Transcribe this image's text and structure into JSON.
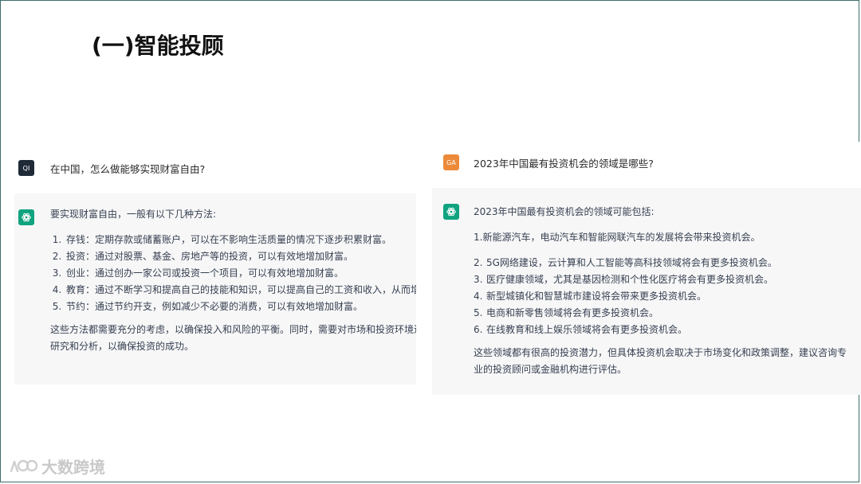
{
  "slide": {
    "title": "(一)智能投顾"
  },
  "left_chat": {
    "user_avatar": "QI",
    "question": "在中国，怎么做能够实现财富自由?",
    "answer": {
      "intro": "要实现财富自由，一般有以下几种方法:",
      "items": [
        "存钱：定期存款或储蓄账户，可以在不影响生活质量的情况下逐步积累财富。",
        "投资：通过对股票、基金、房地产等的投资，可以有效地增加财富。",
        "创业：通过创办一家公司或投资一个项目，可以有效地增加财富。",
        "教育：通过不断学习和提高自己的技能和知识，可以提高自己的工资和收入，从而增加财富。",
        "节约：通过节约开支，例如减少不必要的消费，可以有效地增加财富。"
      ],
      "outro": "这些方法都需要充分的考虑，以确保投入和风险的平衡。同时，需要对市场和投资环境进行充分的研究和分析，以确保投资的成功。"
    }
  },
  "right_chat": {
    "user_avatar": "GA",
    "question": "2023年中国最有投资机会的领域是哪些?",
    "answer": {
      "intro": "2023年中国最有投资机会的领域可能包括:",
      "first": "1.新能源汽车，电动汽车和智能网联汽车的发展将会带来投资机会。",
      "items": [
        {
          "num": "2.",
          "text": "5G网络建设，云计算和人工智能等高科技领域将会有更多投资机会。"
        },
        {
          "num": "3.",
          "text": "医疗健康领域，尤其是基因检测和个性化医疗将会有更多投资机会。"
        },
        {
          "num": "4.",
          "text": "新型城镇化和智慧城市建设将会带来更多投资机会。"
        },
        {
          "num": "5.",
          "text": "电商和新零售领域将会有更多投资机会。"
        },
        {
          "num": "6.",
          "text": "在线教育和线上娱乐领域将会有更多投资机会。"
        }
      ],
      "outro": "这些领域都有很高的投资潜力，但具体投资机会取决于市场变化和政策调整，建议咨询专业的投资顾问或金融机构进行评估。"
    }
  },
  "watermark": {
    "text": "大数跨境"
  },
  "colors": {
    "gpt_green": "#10a37f",
    "user_dark": "#1f2a37",
    "user_orange": "#ec8a3a",
    "answer_bg": "#f7f7f8"
  },
  "icons": {
    "assistant": "openai-logo-icon",
    "watermark": "brand-logo-icon"
  }
}
